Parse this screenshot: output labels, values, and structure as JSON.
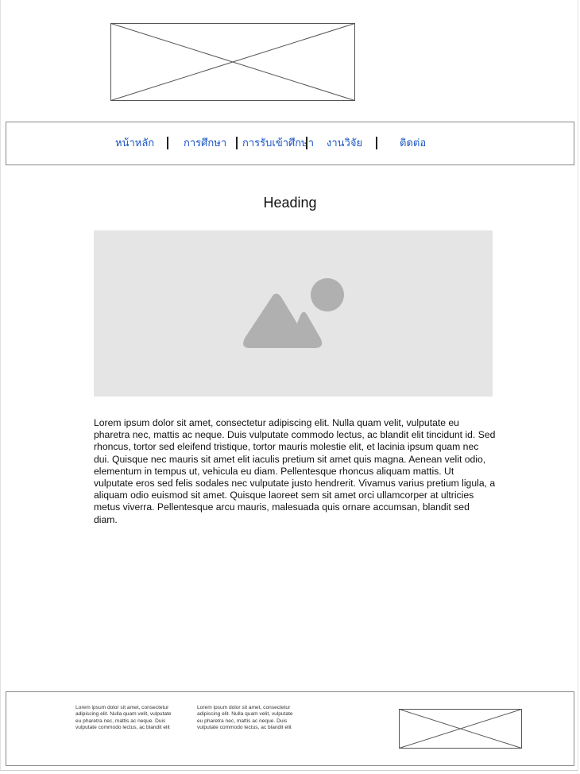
{
  "nav": {
    "items": [
      {
        "label": "หน้าหลัก"
      },
      {
        "label": "การศึกษา"
      },
      {
        "label": "การรับเข้าศึกษา"
      },
      {
        "label": "งานวิจัย"
      },
      {
        "label": "ติดต่อ"
      }
    ]
  },
  "main": {
    "heading": "Heading",
    "hero_image": "image-placeholder-icon",
    "paragraph": "Lorem ipsum dolor sit amet, consectetur adipiscing elit. Nulla quam velit, vulputate eu pharetra nec, mattis ac neque. Duis vulputate commodo lectus, ac blandit elit tincidunt id. Sed rhoncus, tortor sed eleifend tristique, tortor mauris molestie elit, et lacinia ipsum quam nec dui. Quisque nec mauris sit amet elit iaculis pretium sit amet quis magna. Aenean velit odio, elementum in tempus ut, vehicula eu diam. Pellentesque rhoncus aliquam mattis. Ut vulputate eros sed felis sodales nec vulputate justo hendrerit. Vivamus varius pretium ligula, a aliquam odio euismod sit amet. Quisque laoreet sem sit amet orci ullamcorper at ultricies metus viverra. Pellentesque arcu mauris, malesuada quis ornare accumsan, blandit sed diam."
  },
  "footer": {
    "col1": "Lorem ipsum dolor sit amet, consectetur adipiscing elit. Nulla quam velit, vulputate eu pharetra nec, mattis ac neque. Duis vulputate commodo lectus, ac blandit elit",
    "col2": "Lorem ipsum dolor sit amet, consectetur adipiscing elit. Nulla quam velit, vulputate eu pharetra nec, mattis ac neque. Duis vulputate commodo lectus, ac blandit elit"
  },
  "colors": {
    "link": "#1a55c5",
    "placeholder_bg": "#e5e5e5",
    "placeholder_icon": "#b0b0b0"
  }
}
